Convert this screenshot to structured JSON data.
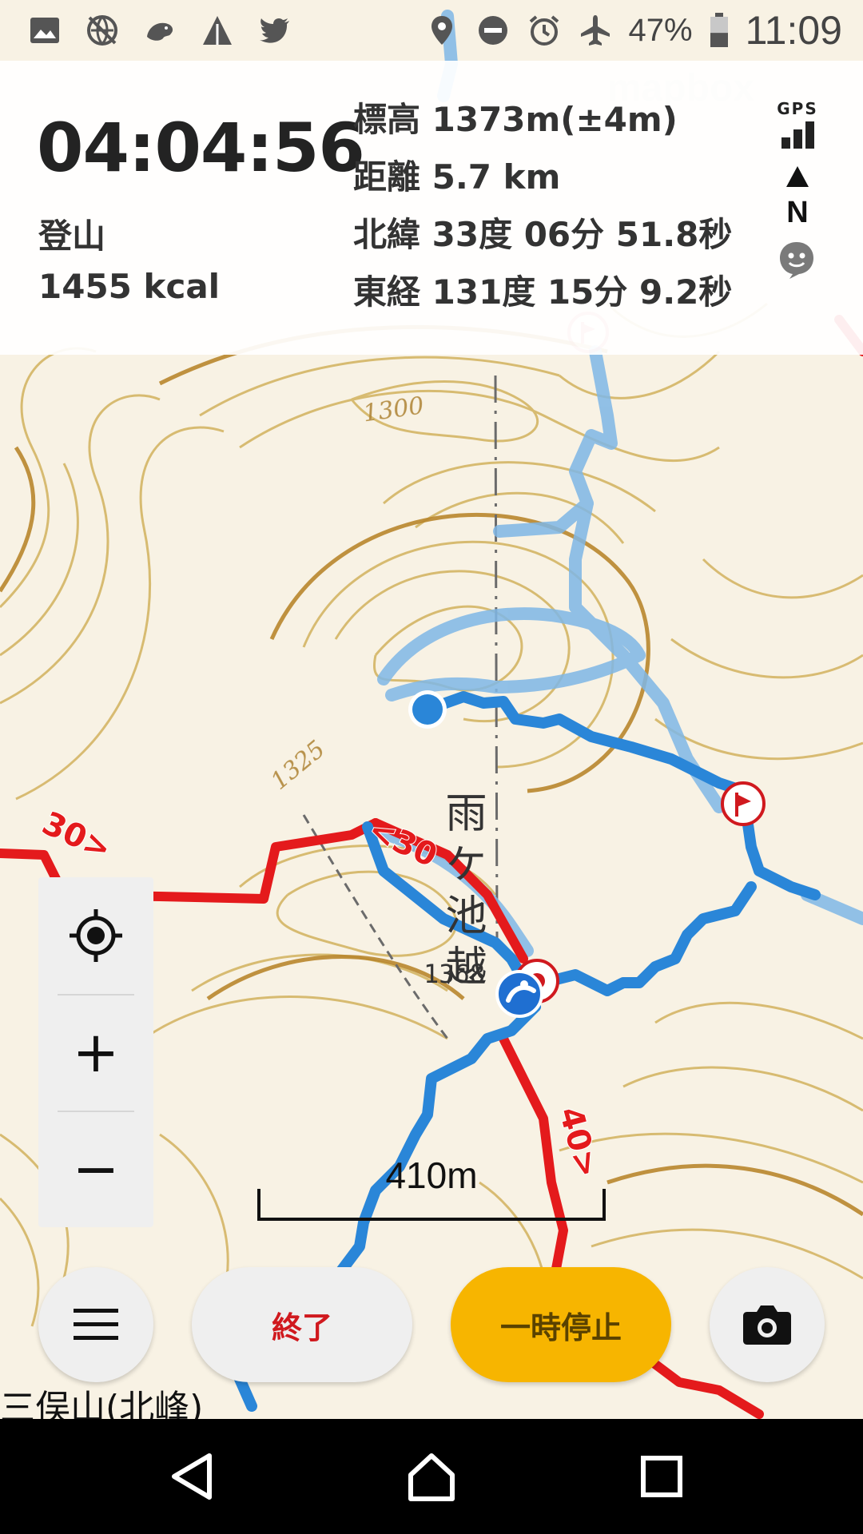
{
  "status_bar": {
    "left_icons": [
      "image-icon",
      "no-network-icon",
      "animal-app-icon",
      "triangle-app-icon",
      "twitter-icon"
    ],
    "right_icons": [
      "location-icon",
      "do-not-disturb-icon",
      "alarm-icon",
      "airplane-mode-icon"
    ],
    "battery_percent": "47%",
    "battery_level": 0.47,
    "time": "11:09"
  },
  "map": {
    "attribution": "mapbox",
    "contour_labels": [
      "1300",
      "1325",
      "1368"
    ],
    "place_label": "雨ケ池越",
    "course_times": [
      "30>",
      "<30",
      "40>"
    ],
    "bottom_label": "三俣山(北峰)"
  },
  "tracking": {
    "elapsed_time": "04:04:56",
    "activity_type": "登山",
    "calories": "1455 kcal",
    "elevation": "標高 1373m(±4m)",
    "distance": "距離 5.7 km",
    "latitude": "北緯 33度 06分 51.8秒",
    "longitude": "東経 131度 15分 9.2秒"
  },
  "indicators": {
    "gps_label": "GPS",
    "gps_signal_bars": 3,
    "north_label": "N"
  },
  "zoom_controls": {
    "locate_icon": "crosshair-icon",
    "zoom_in": "+",
    "zoom_out": "−"
  },
  "scale": {
    "label": "410m"
  },
  "actions": {
    "menu_icon": "hamburger-menu-icon",
    "end_label": "終了",
    "pause_label": "一時停止",
    "camera_icon": "camera-icon"
  },
  "nav_bar": {
    "items": [
      "back-icon",
      "home-icon",
      "recents-icon"
    ]
  },
  "colors": {
    "track_blue": "#2a86d8",
    "route_red": "#e41a1c",
    "pause_button": "#f7b500",
    "end_text": "#d0191e",
    "contour": "#c9a24a"
  }
}
